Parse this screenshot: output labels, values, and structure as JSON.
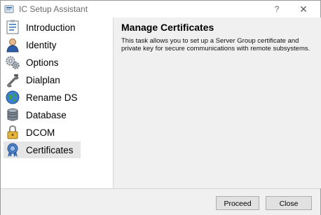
{
  "window": {
    "title": "IC Setup Assistant",
    "help_glyph": "?",
    "close_glyph": "✕"
  },
  "sidebar": {
    "items": [
      {
        "label": "Introduction",
        "icon": "checklist-icon"
      },
      {
        "label": "Identity",
        "icon": "person-icon"
      },
      {
        "label": "Options",
        "icon": "gears-icon"
      },
      {
        "label": "Dialplan",
        "icon": "telephone-icon"
      },
      {
        "label": "Rename DS",
        "icon": "globe-icon"
      },
      {
        "label": "Database",
        "icon": "database-icon"
      },
      {
        "label": "DCOM",
        "icon": "padlock-icon"
      },
      {
        "label": "Certificates",
        "icon": "certificate-icon"
      }
    ],
    "selected": "Certificates"
  },
  "content": {
    "title": "Manage Certificates",
    "description": "This task allows you to set up a Server Group certificate and private key for secure communications with remote subsystems."
  },
  "buttons": {
    "proceed": "Proceed",
    "close": "Close"
  }
}
